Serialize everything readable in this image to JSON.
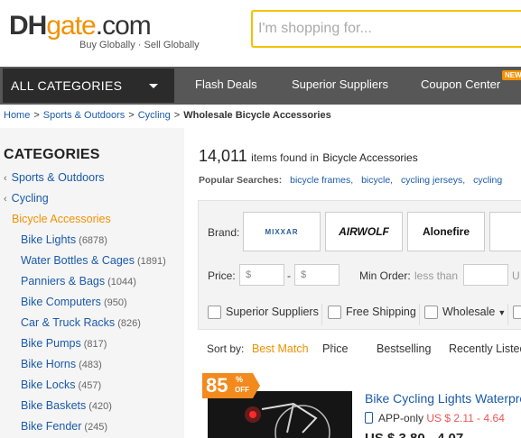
{
  "header": {
    "logo_dh": "DH",
    "logo_gate": "gate",
    "logo_com": ".com",
    "tagline": "Buy Globally · Sell Globally",
    "search_placeholder": "I'm shopping for..."
  },
  "nav": {
    "all_categories": "ALL CATEGORIES",
    "links": [
      "Flash Deals",
      "Superior Suppliers",
      "Coupon Center"
    ],
    "new_badge": "NEW"
  },
  "breadcrumb": {
    "items": [
      "Home",
      "Sports & Outdoors",
      "Cycling"
    ],
    "current": "Wholesale Bicycle Accessories",
    "separator": ">"
  },
  "sidebar": {
    "title": "CATEGORIES",
    "parents": [
      "Sports & Outdoors",
      "Cycling"
    ],
    "current": "Bicycle Accessories",
    "items": [
      {
        "label": "Bike Lights",
        "count": "(6878)"
      },
      {
        "label": "Water Bottles & Cages",
        "count": "(1891)"
      },
      {
        "label": "Panniers & Bags",
        "count": "(1044)"
      },
      {
        "label": "Bike Computers",
        "count": "(950)"
      },
      {
        "label": "Car & Truck Racks",
        "count": "(826)"
      },
      {
        "label": "Bike Pumps",
        "count": "(817)"
      },
      {
        "label": "Bike Horns",
        "count": "(483)"
      },
      {
        "label": "Bike Locks",
        "count": "(457)"
      },
      {
        "label": "Bike Baskets",
        "count": "(420)"
      },
      {
        "label": "Bike Fender",
        "count": "(245)"
      }
    ]
  },
  "results": {
    "count": "14,011",
    "found_text": "items found in",
    "category": "Bicycle Accessories"
  },
  "popular": {
    "label": "Popular Searches:",
    "links": [
      "bicycle frames,",
      "bicycle,",
      "cycling jerseys,",
      "cycling"
    ]
  },
  "filters": {
    "brand_label": "Brand:",
    "brands": [
      "MIXXAR",
      "AIRWOLF",
      "Alonefire"
    ],
    "price_label": "Price:",
    "price_min_placeholder": "$",
    "price_max_placeholder": "$",
    "price_dash": "-",
    "min_order_label": "Min Order:",
    "less_than": "less than",
    "units_cut": "U",
    "checkboxes": [
      "Superior Suppliers",
      "Free Shipping",
      "Wholesale"
    ]
  },
  "sort": {
    "label": "Sort by:",
    "options": [
      "Best Match",
      "Price",
      "Bestselling",
      "Recently Listed"
    ]
  },
  "product": {
    "discount": "85",
    "discount_pct": "%",
    "discount_off": "OFF",
    "title": "Bike Cycling Lights Waterproof",
    "app_only": "APP-only",
    "app_price": "US $ 2.11 - 4.64",
    "price2": "US $ 3.80 - 4.07"
  },
  "colors": {
    "accent": "#f29100",
    "link": "#1a5aa8",
    "nav_bg": "#575757",
    "allcat_bg": "#2b2b2b",
    "search_border": "#f2c200",
    "badge": "#f28a1e"
  }
}
